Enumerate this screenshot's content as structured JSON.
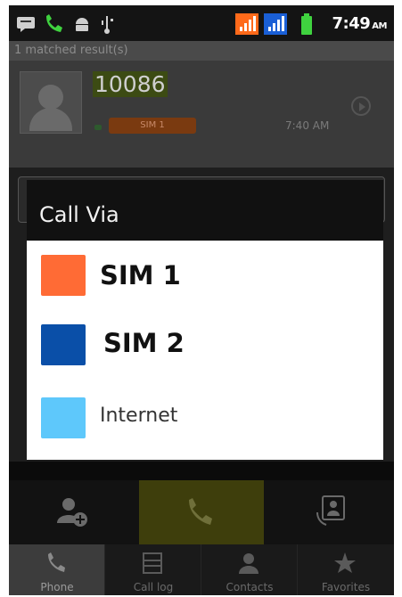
{
  "status_bar": {
    "time": "7:49",
    "ampm": "AM",
    "icons": [
      "message-icon",
      "phone-icon",
      "android-icon",
      "usb-icon",
      "signal-sim1-icon",
      "signal-sim2-icon",
      "battery-icon"
    ],
    "colors": {
      "sim1_signal": "#ff6a1a",
      "sim2_signal": "#1a5fd6",
      "battery": "#3fd23f"
    }
  },
  "background": {
    "results_label": "1 matched result(s)",
    "entry": {
      "number": "10086",
      "sim_tag": "SIM 1",
      "time": "7:40 AM"
    }
  },
  "dialog": {
    "title": "Call Via",
    "options": [
      {
        "label": "SIM 1",
        "color": "#ff6b35"
      },
      {
        "label": "SIM 2",
        "color": "#0a4fa8"
      },
      {
        "label": "Internet",
        "color": "#5ec8fb"
      }
    ]
  },
  "actions": [
    "add-contact-icon",
    "call-icon",
    "contact-card-icon"
  ],
  "tabs": [
    {
      "label": "Phone",
      "icon": "phone-icon",
      "active": true
    },
    {
      "label": "Call log",
      "icon": "call-log-icon",
      "active": false
    },
    {
      "label": "Contacts",
      "icon": "contacts-icon",
      "active": false
    },
    {
      "label": "Favorites",
      "icon": "star-icon",
      "active": false
    }
  ]
}
